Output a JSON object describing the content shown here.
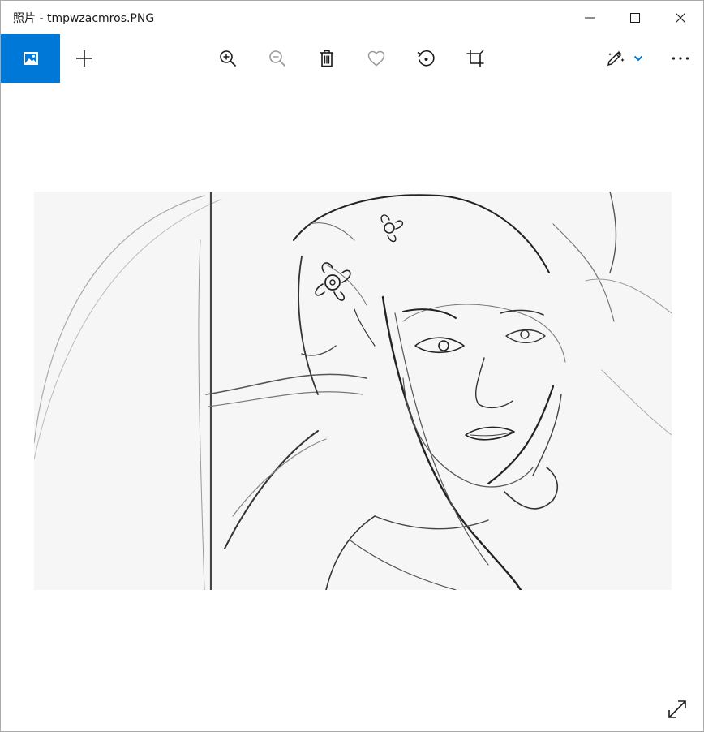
{
  "window": {
    "title": "照片 - tmpwzacmros.PNG"
  },
  "titlebar_controls": {
    "minimize_icon": "minimize-icon",
    "maximize_icon": "maximize-icon",
    "close_icon": "close-icon"
  },
  "toolbar": {
    "gallery_icon": "image-gallery-icon",
    "add_icon": "plus-icon",
    "zoom_in_icon": "zoom-in-icon",
    "zoom_out_icon": "zoom-out-icon",
    "delete_icon": "trash-icon",
    "favorite_icon": "heart-icon",
    "rotate_icon": "rotate-icon",
    "crop_icon": "crop-icon",
    "edit_icon": "edit-pen-icon",
    "more_icon": "more-ellipsis-icon"
  },
  "colors": {
    "accent": "#0078d7",
    "icon": "#1a1a1a",
    "icon_disabled": "#9a9a9a"
  },
  "viewer": {
    "fullscreen_icon": "fullscreen-expand-icon"
  }
}
